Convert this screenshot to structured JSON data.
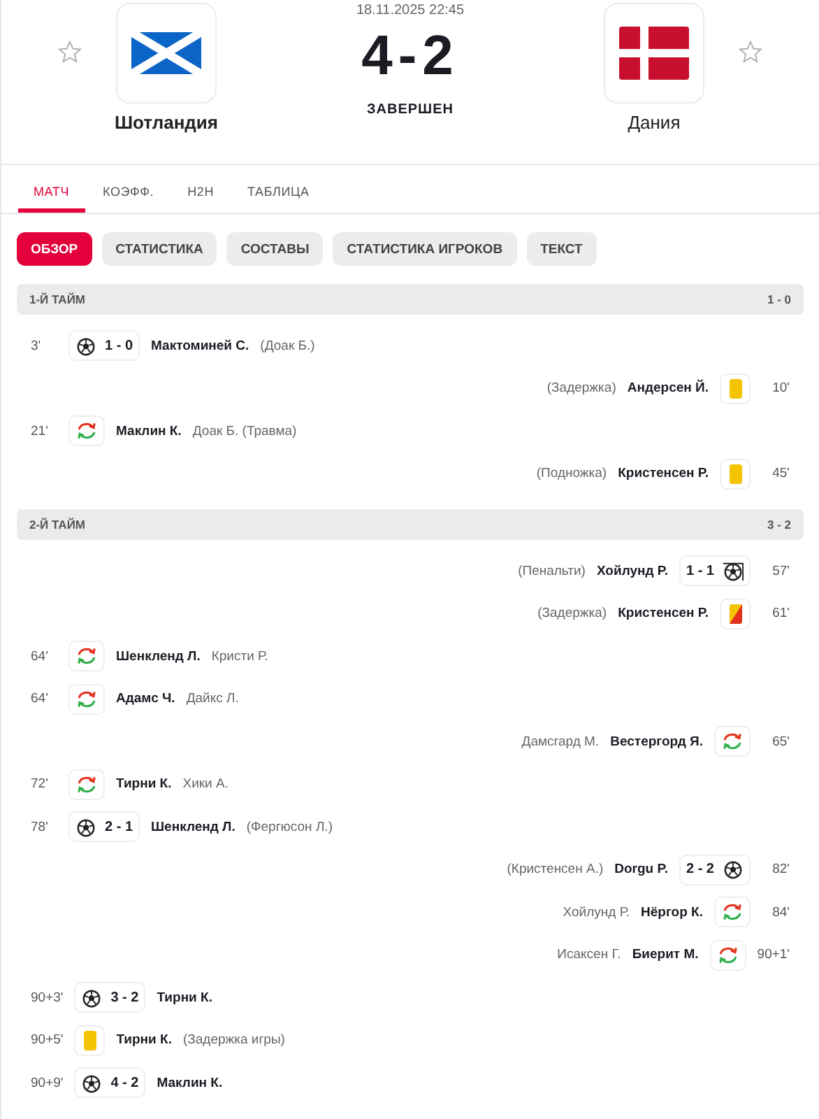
{
  "header": {
    "home": {
      "name": "Шотландия"
    },
    "away": {
      "name": "Дания"
    },
    "datetime": "18.11.2025 22:45",
    "score": "4-2",
    "status": "ЗАВЕРШЕН"
  },
  "tabs": [
    {
      "label": "МАТЧ",
      "selected": true
    },
    {
      "label": "КОЭФФ.",
      "selected": false
    },
    {
      "label": "H2H",
      "selected": false
    },
    {
      "label": "ТАБЛИЦА",
      "selected": false
    }
  ],
  "subtabs": [
    {
      "label": "ОБЗОР",
      "selected": true
    },
    {
      "label": "СТАТИСТИКА",
      "selected": false
    },
    {
      "label": "СОСТАВЫ",
      "selected": false
    },
    {
      "label": "СТАТИСТИКА ИГРОКОВ",
      "selected": false
    },
    {
      "label": "ТЕКСТ",
      "selected": false
    }
  ],
  "periods": [
    {
      "title": "1-Й ТАЙМ",
      "score": "1 - 0",
      "events": [
        {
          "away": false,
          "kind": "goal",
          "minute": "3'",
          "score": "1 - 0",
          "player": "Мактоминей С.",
          "note": "(Доак Б.)"
        },
        {
          "away": true,
          "kind": "yellow",
          "minute": "10'",
          "player": "Андерсен Й.",
          "note": "(Задержка)"
        },
        {
          "away": false,
          "kind": "sub",
          "minute": "21'",
          "player": "Маклин К.",
          "note": "Доак Б. (Травма)"
        },
        {
          "away": true,
          "kind": "yellow",
          "minute": "45'",
          "player": "Кристенсен Р.",
          "note": "(Подножка)"
        }
      ]
    },
    {
      "title": "2-Й ТАЙМ",
      "score": "3 - 2",
      "events": [
        {
          "away": true,
          "kind": "penalty",
          "minute": "57'",
          "score": "1 - 1",
          "player": "Хойлунд Р.",
          "note": "(Пенальти)"
        },
        {
          "away": true,
          "kind": "yellowred",
          "minute": "61'",
          "player": "Кристенсен Р.",
          "note": "(Задержка)"
        },
        {
          "away": false,
          "kind": "sub",
          "minute": "64'",
          "player": "Шенкленд Л.",
          "note": "Кристи Р."
        },
        {
          "away": false,
          "kind": "sub",
          "minute": "64'",
          "player": "Адамс Ч.",
          "note": "Дайкс Л."
        },
        {
          "away": true,
          "kind": "sub",
          "minute": "65'",
          "player": "Вестергорд Я.",
          "note": "Дамсгард М."
        },
        {
          "away": false,
          "kind": "sub",
          "minute": "72'",
          "player": "Тирни К.",
          "note": "Хики А."
        },
        {
          "away": false,
          "kind": "goal",
          "minute": "78'",
          "score": "2 - 1",
          "player": "Шенкленд Л.",
          "note": "(Фергюсон Л.)"
        },
        {
          "away": true,
          "kind": "goal",
          "minute": "82'",
          "score": "2 - 2",
          "player": "Dorgu P.",
          "note": "(Кристенсен А.)"
        },
        {
          "away": true,
          "kind": "sub",
          "minute": "84'",
          "player": "Нёргор К.",
          "note": "Хойлунд Р."
        },
        {
          "away": true,
          "kind": "sub",
          "minute": "90+1'",
          "player": "Биерит М.",
          "note": "Исаксен Г."
        },
        {
          "away": false,
          "kind": "goal",
          "minute": "90+3'",
          "score": "3 - 2",
          "player": "Тирни К."
        },
        {
          "away": false,
          "kind": "yellow",
          "minute": "90+5'",
          "player": "Тирни К.",
          "note": "(Задержка игры)"
        },
        {
          "away": false,
          "kind": "goal",
          "minute": "90+9'",
          "score": "4 - 2",
          "player": "Маклин К."
        }
      ]
    }
  ]
}
